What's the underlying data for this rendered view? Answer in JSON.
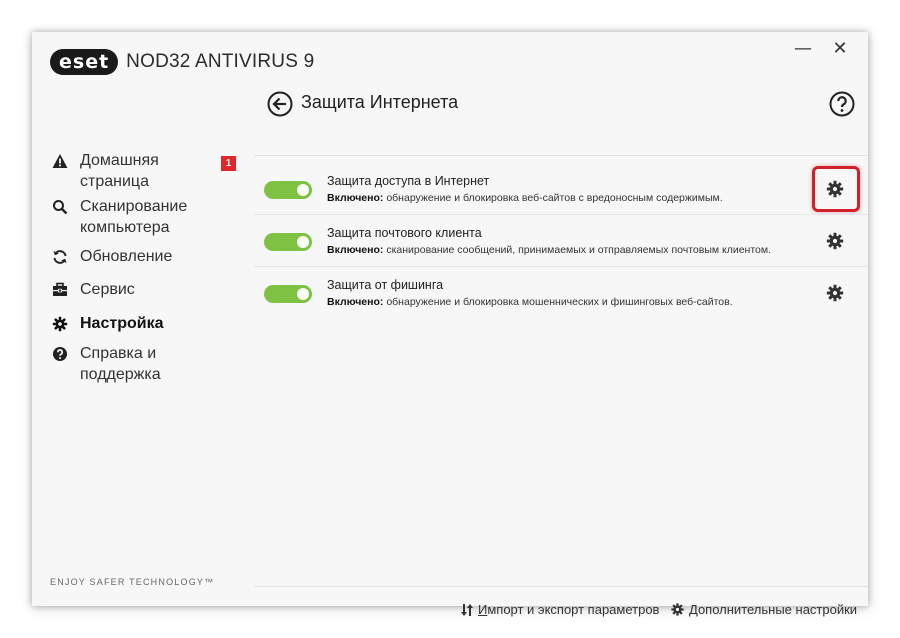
{
  "app": {
    "logo_text": "eset",
    "product": "NOD32 ANTIVIRUS 9",
    "minimize": "—",
    "close": "✕",
    "tagline": "ENJOY SAFER TECHNOLOGY™"
  },
  "sidebar": {
    "items": [
      {
        "label": "Домашняя страница",
        "icon": "warning-icon",
        "badge": "1",
        "active": false
      },
      {
        "label": "Сканирование компьютера",
        "icon": "search-icon",
        "active": false
      },
      {
        "label": "Обновление",
        "icon": "refresh-icon",
        "active": false
      },
      {
        "label": "Сервис",
        "icon": "toolbox-icon",
        "active": false
      },
      {
        "label": "Настройка",
        "icon": "gear-icon",
        "active": true
      },
      {
        "label": "Справка и поддержка",
        "icon": "help-icon",
        "active": false
      }
    ]
  },
  "main": {
    "title": "Защита Интернета",
    "rows": [
      {
        "title": "Защита доступа в Интернет",
        "status": "Включено:",
        "desc": " обнаружение и блокировка веб-сайтов с вредоносным содержимым.",
        "enabled": true,
        "highlighted": true
      },
      {
        "title": "Защита почтового клиента",
        "status": "Включено:",
        "desc": " сканирование сообщений, принимаемых и отправляемых почтовым клиентом.",
        "enabled": true,
        "highlighted": false
      },
      {
        "title": "Защита от фишинга",
        "status": "Включено:",
        "desc": " обнаружение и блокировка мошеннических и фишинговых веб-сайтов.",
        "enabled": true,
        "highlighted": false
      }
    ],
    "footer": {
      "import_export_first": "И",
      "import_export_rest": "мпорт и экспорт параметров",
      "advanced_first": "Д",
      "advanced_rest": "ополнительные настройки"
    }
  },
  "colors": {
    "toggle_on": "#7dc242",
    "badge": "#e2262a",
    "highlight": "#d0212a"
  }
}
